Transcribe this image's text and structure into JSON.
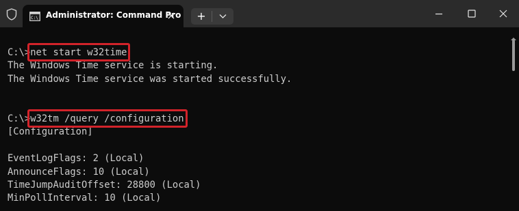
{
  "titlebar": {
    "tab_title": "Administrator: Command Pro",
    "new_tab_label": "+"
  },
  "terminal": {
    "lines": [
      {
        "prompt": "C:\\>",
        "command": "net start w32time",
        "highlighted": true
      },
      {
        "text": "The Windows Time service is starting."
      },
      {
        "text": "The Windows Time service was started successfully."
      },
      {
        "text": ""
      },
      {
        "text": ""
      },
      {
        "prompt": "C:\\>",
        "command": "w32tm /query /configuration",
        "highlighted": true
      },
      {
        "text": "[Configuration]"
      },
      {
        "text": ""
      },
      {
        "text": "EventLogFlags: 2 (Local)"
      },
      {
        "text": "AnnounceFlags: 10 (Local)"
      },
      {
        "text": "TimeJumpAuditOffset: 28800 (Local)"
      },
      {
        "text": "MinPollInterval: 10 (Local)"
      }
    ]
  },
  "colors": {
    "background": "#0c0c0c",
    "titlebar": "#2b2b2b",
    "text": "#cccccc",
    "highlight_box": "#d2232a"
  },
  "icons": {
    "shield": "shield-icon",
    "tab": "command-prompt-icon",
    "tab_close": "close-icon",
    "new_tab": "plus-icon",
    "dropdown": "chevron-down-icon",
    "minimize": "minimize-icon",
    "maximize": "maximize-icon",
    "close": "close-icon"
  }
}
